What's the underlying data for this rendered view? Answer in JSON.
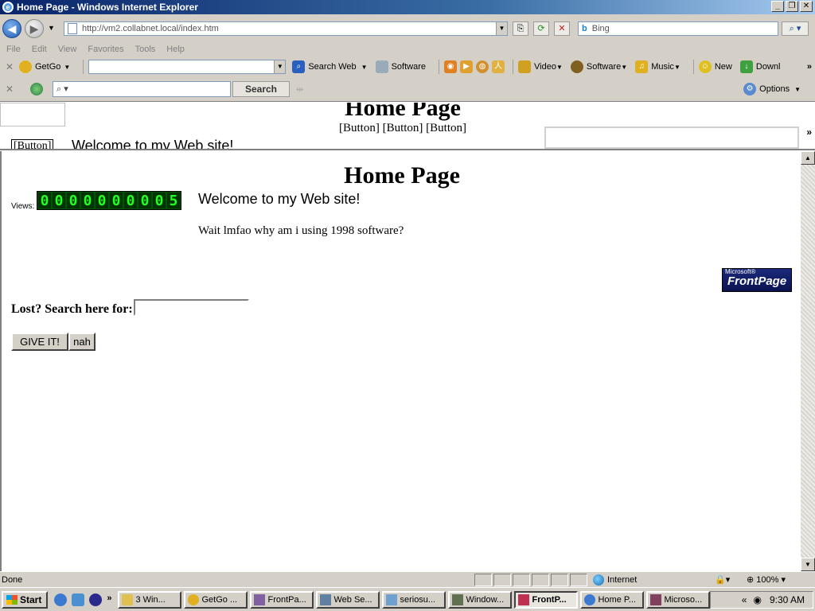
{
  "window": {
    "title": "Home Page - Windows Internet Explorer",
    "min": "_",
    "max": "❐",
    "close": "✕"
  },
  "address": {
    "url": "http://vm2.collabnet.local/index.htm",
    "search_placeholder": "Bing"
  },
  "menu": [
    "File",
    "Edit",
    "View",
    "Favorites",
    "Tools",
    "Help"
  ],
  "toolbar1": {
    "getgo": "GetGo",
    "search_web": "Search Web",
    "software1": "Software",
    "video": "Video",
    "software2": "Software",
    "music": "Music",
    "new": "New",
    "download": "Downl"
  },
  "toolbar2": {
    "search_button": "Search",
    "options": "Options"
  },
  "frame": {
    "title": "Home Page",
    "buttons": "[Button] [Button] [Button]",
    "left_button": "[Button]",
    "welcome": "Welcome to my Web site!"
  },
  "page": {
    "title": "Home Page",
    "views_label": "Views:",
    "counter": [
      "0",
      "0",
      "0",
      "0",
      "0",
      "0",
      "0",
      "0",
      "0",
      "5"
    ],
    "welcome": "Welcome to my Web site!",
    "wait_text": "Wait lmfao why am i using 1998 software?",
    "frontpage_small": "Microsoft®",
    "frontpage": "FrontPage",
    "search_label": "Lost? Search here for:",
    "search_value": "",
    "give_button": "GIVE IT!",
    "nah_button": "nah"
  },
  "status": {
    "text": "Done",
    "zone": "Internet",
    "zoom": "100%"
  },
  "taskbar": {
    "start": "Start",
    "tasks": [
      "3 Win...",
      "GetGo ...",
      "FrontPa...",
      "Web Se...",
      "seriosu...",
      "Window...",
      "FrontP...",
      "Home P...",
      "Microso..."
    ],
    "active_index": 6,
    "clock": "9:30 AM"
  }
}
